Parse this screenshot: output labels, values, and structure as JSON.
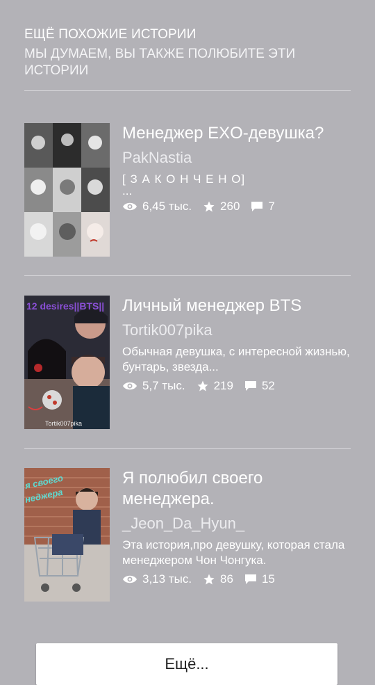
{
  "section": {
    "title": "ЕЩЁ ПОХОЖИЕ ИСТОРИИ",
    "subtitle": "МЫ ДУМАЕМ, ВЫ ТАКЖЕ ПОЛЮБИТЕ ЭТИ ИСТОРИИ"
  },
  "stories": [
    {
      "title": "Менеджер EXO-девушка?",
      "author": "PakNastia",
      "description_line1": "[ З А К О Н Ч Е Н О]",
      "description_line2": "...",
      "reads": "6,45 тыс.",
      "votes": "260",
      "comments": "7",
      "cover_icon": "book-cover-collage"
    },
    {
      "title": "Личный менеджер BTS",
      "author": "Tortik007pika",
      "description": "Обычная девушка, с интересной жизнью, бунтарь, звезда...",
      "reads": "5,7 тыс.",
      "votes": "219",
      "comments": "52",
      "cover_text": "12 desires||BTS||",
      "cover_signature": "Tortik007pika"
    },
    {
      "title": "Я полюбил своего менеджера.",
      "author": "_Jeon_Da_Hyun_",
      "description": "Эта история,про девушку, которая стала менеджером Чон Чонгука.",
      "reads": "3,13 тыс.",
      "votes": "86",
      "comments": "15",
      "cover_text": "я своего\nнеджера"
    }
  ],
  "more_button": {
    "label": "Ещё..."
  },
  "colors": {
    "background": "#b3b2b7",
    "text": "#ffffff",
    "button": "#ffffff"
  },
  "icons": [
    "eye-icon",
    "star-icon",
    "comment-icon"
  ]
}
